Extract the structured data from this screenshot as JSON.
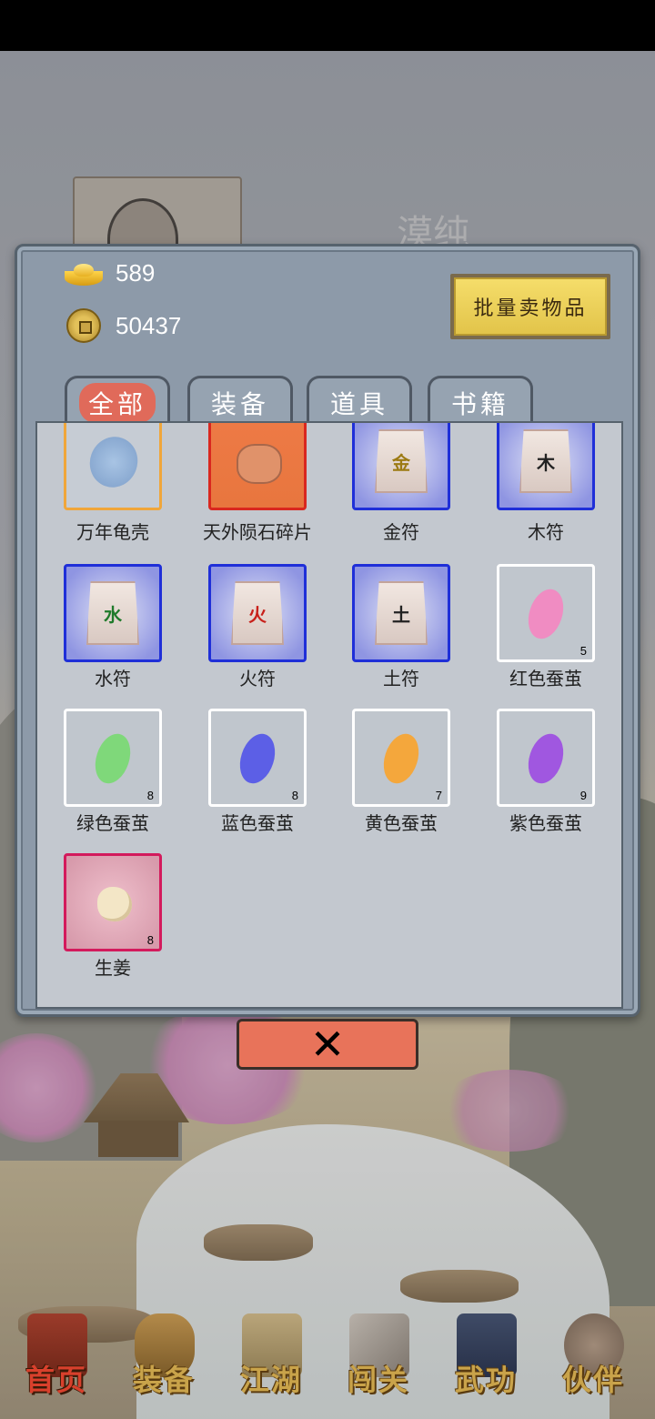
{
  "background": {
    "character_name": "漠纯"
  },
  "currency": {
    "gold": "589",
    "coins": "50437"
  },
  "panel": {
    "bulk_sell_label": "批量卖物品",
    "tabs": [
      {
        "label": "全部",
        "active": true
      },
      {
        "label": "装备",
        "active": false
      },
      {
        "label": "道具",
        "active": false
      },
      {
        "label": "书籍",
        "active": false
      }
    ]
  },
  "items": [
    {
      "name": "万年龟壳",
      "rarity_color": "#f0a63a",
      "icon": "turtle-shell-icon",
      "count": ""
    },
    {
      "name": "天外陨石碎片",
      "rarity_color": "#d9271f",
      "icon": "meteorite-fragment-icon",
      "count": ""
    },
    {
      "name": "金符",
      "rarity_color": "#1f2fd8",
      "icon": "talisman-icon",
      "glyph": "金",
      "count": ""
    },
    {
      "name": "木符",
      "rarity_color": "#1f2fd8",
      "icon": "talisman-icon",
      "glyph": "木",
      "count": ""
    },
    {
      "name": "水符",
      "rarity_color": "#1f2fd8",
      "icon": "talisman-icon",
      "glyph": "水",
      "count": ""
    },
    {
      "name": "火符",
      "rarity_color": "#1f2fd8",
      "icon": "talisman-icon",
      "glyph": "火",
      "count": ""
    },
    {
      "name": "土符",
      "rarity_color": "#1f2fd8",
      "icon": "talisman-icon",
      "glyph": "土",
      "count": ""
    },
    {
      "name": "红色蚕茧",
      "rarity_color": "#ffffff",
      "icon": "cocoon-icon",
      "tint": "#f08cc2",
      "count": "5"
    },
    {
      "name": "绿色蚕茧",
      "rarity_color": "#ffffff",
      "icon": "cocoon-icon",
      "tint": "#7fd87a",
      "count": "8"
    },
    {
      "name": "蓝色蚕茧",
      "rarity_color": "#ffffff",
      "icon": "cocoon-icon",
      "tint": "#5c5fe6",
      "count": "8"
    },
    {
      "name": "黄色蚕茧",
      "rarity_color": "#ffffff",
      "icon": "cocoon-icon",
      "tint": "#f4a73c",
      "count": "7"
    },
    {
      "name": "紫色蚕茧",
      "rarity_color": "#ffffff",
      "icon": "cocoon-icon",
      "tint": "#a057e0",
      "count": "9"
    },
    {
      "name": "生姜",
      "rarity_color": "#d31a5c",
      "icon": "ginger-icon",
      "count": "8"
    }
  ],
  "bottom_nav": [
    {
      "label": "首页",
      "icon": "house-icon",
      "active": true
    },
    {
      "label": "装备",
      "icon": "armor-icon",
      "active": false
    },
    {
      "label": "江湖",
      "icon": "scroll-icon",
      "active": false
    },
    {
      "label": "闯关",
      "icon": "crossed-swords-icon",
      "active": false
    },
    {
      "label": "武功",
      "icon": "book-icon",
      "active": false
    },
    {
      "label": "伙伴",
      "icon": "companions-icon",
      "active": false
    }
  ]
}
